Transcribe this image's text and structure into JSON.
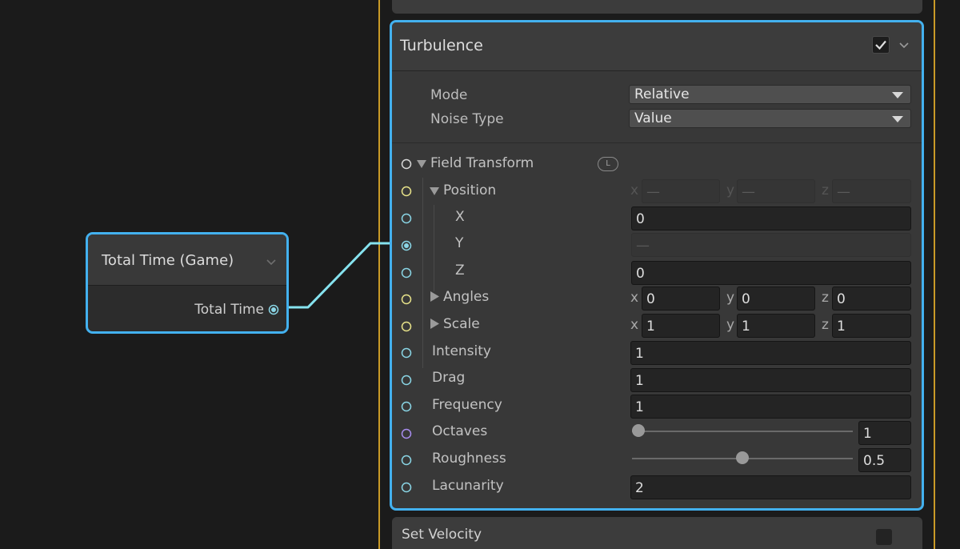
{
  "total_time_node": {
    "title": "Total Time (Game)",
    "output_port_label": "Total Time"
  },
  "next_block": {
    "title": "Set Velocity"
  },
  "turbulence_block": {
    "title": "Turbulence",
    "enabled": true,
    "settings": {
      "mode_label": "Mode",
      "mode_value": "Relative",
      "noise_type_label": "Noise Type",
      "noise_type_value": "Value"
    },
    "field_transform": {
      "label": "Field Transform",
      "space_badge": "L",
      "position": {
        "label": "Position",
        "summary_x_axis": "x",
        "summary_x_value": "—",
        "summary_y_axis": "y",
        "summary_y_value": "—",
        "summary_z_axis": "z",
        "summary_z_value": "—",
        "x_label": "X",
        "x_value": "0",
        "y_label": "Y",
        "y_value": "—",
        "z_label": "Z",
        "z_value": "0"
      },
      "angles": {
        "label": "Angles",
        "x_axis": "x",
        "x_value": "0",
        "y_axis": "y",
        "y_value": "0",
        "z_axis": "z",
        "z_value": "0"
      },
      "scale": {
        "label": "Scale",
        "x_axis": "x",
        "x_value": "1",
        "y_axis": "y",
        "y_value": "1",
        "z_axis": "z",
        "z_value": "1"
      }
    },
    "intensity": {
      "label": "Intensity",
      "value": "1"
    },
    "drag": {
      "label": "Drag",
      "value": "1"
    },
    "frequency": {
      "label": "Frequency",
      "value": "1"
    },
    "octaves": {
      "label": "Octaves",
      "value": "1",
      "slider_fraction": 0.0
    },
    "roughness": {
      "label": "Roughness",
      "value": "0.5",
      "slider_fraction": 0.5
    },
    "lacunarity": {
      "label": "Lacunarity",
      "value": "2"
    }
  },
  "colors": {
    "selection_outline": "#43b1ef",
    "context_outline": "#c99a27",
    "port_float": "#8ad6e6",
    "port_vector": "#e8e38a",
    "port_transform": "#d9d9d9",
    "port_int": "#a88df0",
    "wire": "#86e3ef"
  }
}
